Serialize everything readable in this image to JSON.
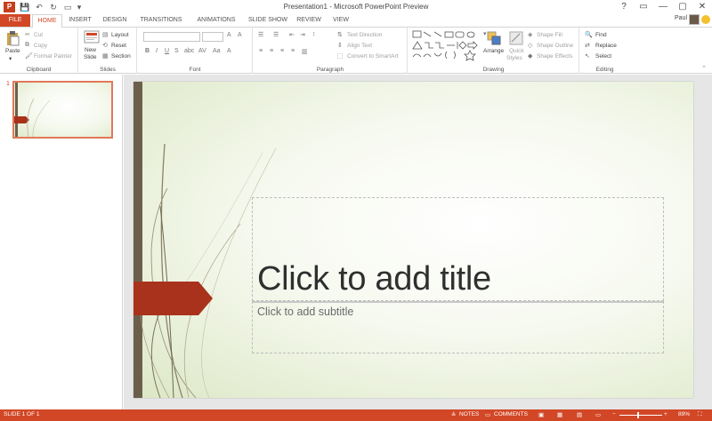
{
  "window": {
    "title": "Presentation1 - Microsoft PowerPoint Preview",
    "app_icon": "P",
    "controls": [
      "?",
      "▭",
      "—",
      "▢",
      "✕"
    ]
  },
  "qat": {
    "items": [
      "save-icon",
      "undo-icon",
      "redo-icon",
      "presenter-icon"
    ]
  },
  "tabs": [
    "FILE",
    "HOME",
    "INSERT",
    "DESIGN",
    "TRANSITIONS",
    "ANIMATIONS",
    "SLIDE SHOW",
    "REVIEW",
    "VIEW"
  ],
  "active_tab": "HOME",
  "user": {
    "name": "Paul"
  },
  "ribbon": {
    "clipboard": {
      "label": "Clipboard",
      "paste": "Paste",
      "cut": "Cut",
      "copy": "Copy",
      "format_painter": "Format Painter"
    },
    "slides": {
      "label": "Slides",
      "new_slide": "New",
      "new_slide2": "Slide",
      "layout": "Layout",
      "reset": "Reset",
      "section": "Section"
    },
    "font": {
      "label": "Font"
    },
    "paragraph": {
      "label": "Paragraph",
      "text_direction": "Text Direction",
      "align_text": "Align Text",
      "convert_smartart": "Convert to SmartArt"
    },
    "drawing": {
      "label": "Drawing",
      "arrange": "Arrange",
      "quick_styles": "Quick",
      "quick_styles2": "Styles",
      "shape_fill": "Shape Fill",
      "shape_outline": "Shape Outline",
      "shape_effects": "Shape Effects"
    },
    "editing": {
      "label": "Editing",
      "find": "Find",
      "replace": "Replace",
      "select": "Select"
    }
  },
  "slides_pane": {
    "slide_number": "1"
  },
  "slide": {
    "title_placeholder": "Click to add title",
    "subtitle_placeholder": "Click to add subtitle"
  },
  "status": {
    "slide_info": "SLIDE 1 OF 1",
    "notes": "NOTES",
    "comments": "COMMENTS",
    "zoom": "89%"
  },
  "colors": {
    "accent": "#d24726",
    "slide_bar": "#6b5f4b",
    "slide_arrow": "#a8321b"
  }
}
